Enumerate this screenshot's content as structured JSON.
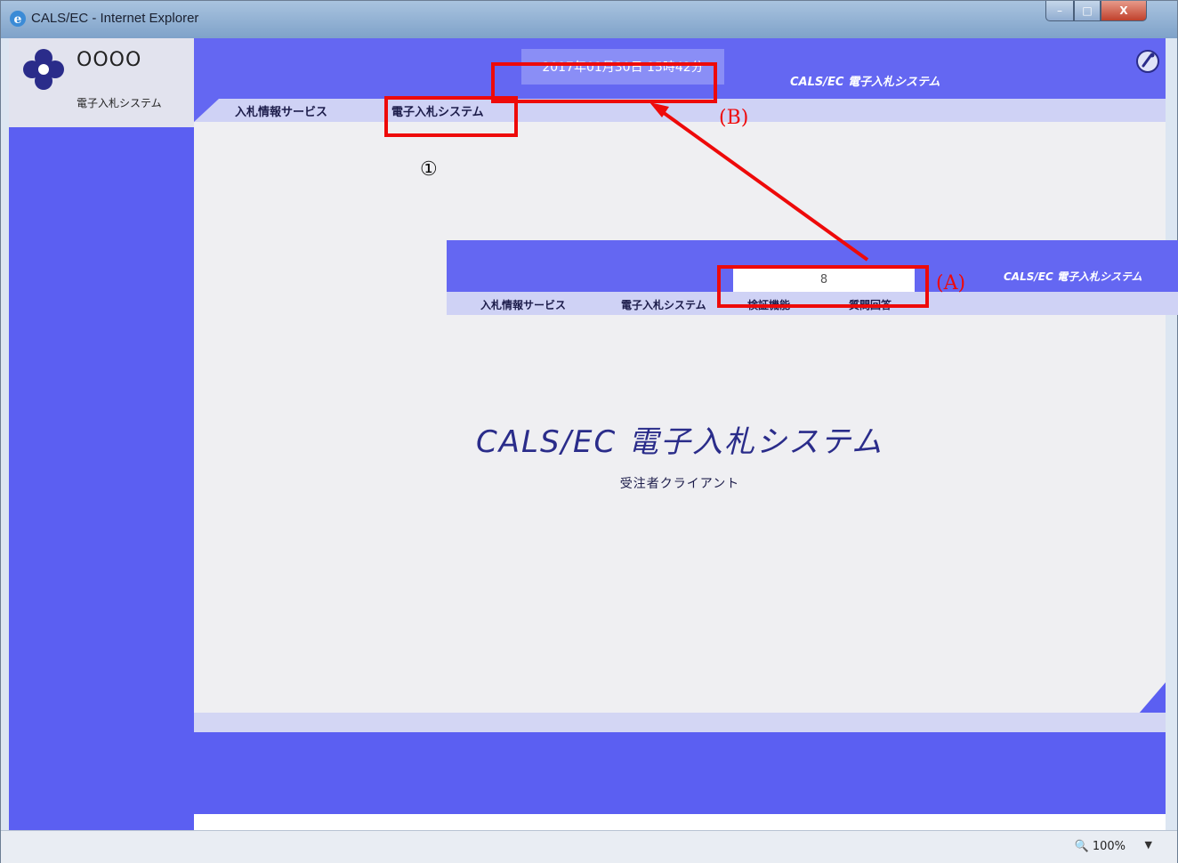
{
  "window": {
    "title": "CALS/EC - Internet Explorer",
    "close_glyph": "X",
    "max_glyph": "□",
    "min_glyph": "–"
  },
  "logo": {
    "title": "OOOO",
    "subtitle": "電子入札システム"
  },
  "header": {
    "datetime": "2017年01月30日 15時42分",
    "system_title": "CALS/EC 電子入札システム"
  },
  "menu": {
    "items": [
      "入札情報サービス",
      "電子入札システム"
    ]
  },
  "content": {
    "title": "CALS/EC 電子入札システム",
    "subtitle": "受注者クライアント"
  },
  "inset": {
    "system_title": "CALS/EC 電子入札システム",
    "menu_items": [
      "入札情報サービス",
      "電子入札システム",
      "検証機能",
      "質問回答"
    ],
    "glyph": "8"
  },
  "annotations": {
    "circle_one": "①",
    "label_a": "(A)",
    "label_b": "(B)",
    "color": "#ee0a0a"
  },
  "status": {
    "zoom": "100%",
    "zoom_icon": "🔍"
  }
}
